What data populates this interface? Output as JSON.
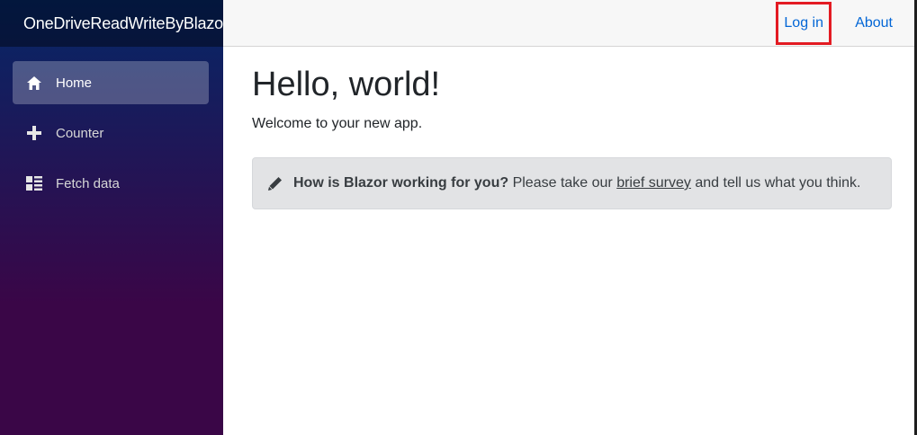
{
  "brand": "OneDriveReadWriteByBlazor",
  "sidebar": {
    "items": [
      {
        "label": "Home",
        "icon": "home-icon",
        "active": true
      },
      {
        "label": "Counter",
        "icon": "plus-icon",
        "active": false
      },
      {
        "label": "Fetch data",
        "icon": "list-rich-icon",
        "active": false
      }
    ]
  },
  "top_row": {
    "login": "Log in",
    "about": "About"
  },
  "main": {
    "title": "Hello, world!",
    "welcome": "Welcome to your new app.",
    "survey": {
      "icon": "pencil-icon",
      "question": "How is Blazor working for you?",
      "before_link": " Please take our ",
      "link": "brief survey",
      "after_link": " and tell us what you think."
    }
  },
  "colors": {
    "sidebar_top": "#052767",
    "sidebar_bottom": "#3a0647",
    "link": "#0366d6",
    "highlight_border": "#e31b23"
  }
}
